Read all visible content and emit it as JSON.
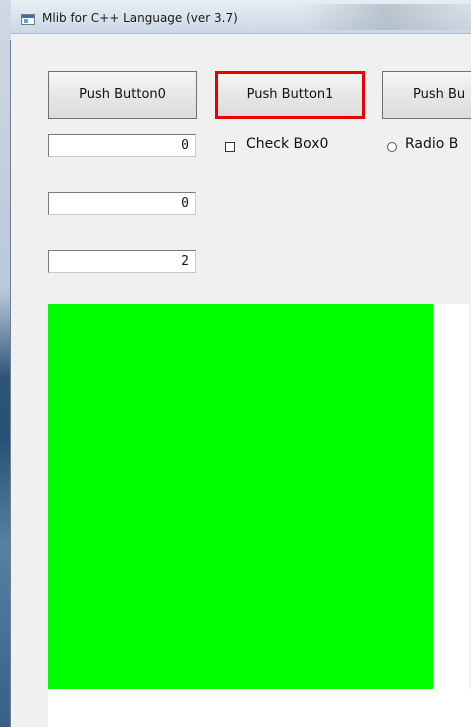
{
  "window": {
    "title": "Mlib for C++ Language  (ver 3.7)"
  },
  "buttons": [
    {
      "label": "Push Button0",
      "focused": false
    },
    {
      "label": "Push Button1",
      "focused": true
    },
    {
      "label": "Push Bu",
      "focused": false
    }
  ],
  "textboxes": [
    {
      "value": "0"
    },
    {
      "value": "0"
    },
    {
      "value": "2"
    }
  ],
  "checkbox": {
    "label": "Check Box0",
    "checked": false
  },
  "radio": {
    "label": "Radio B",
    "selected": false
  },
  "drawing": {
    "fill_color": "#00ff00",
    "background": "#ffffff"
  },
  "colors": {
    "focus_border": "#e60000"
  }
}
